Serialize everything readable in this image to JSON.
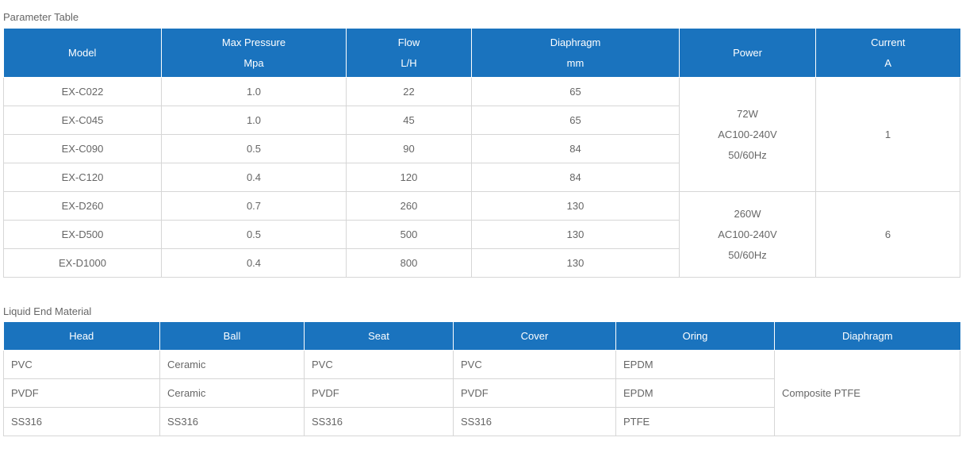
{
  "parameter_table": {
    "title": "Parameter Table",
    "headers": [
      {
        "l1": "Model",
        "l2": ""
      },
      {
        "l1": "Max Pressure",
        "l2": "Mpa"
      },
      {
        "l1": "Flow",
        "l2": "L/H"
      },
      {
        "l1": "Diaphragm",
        "l2": "mm"
      },
      {
        "l1": "Power",
        "l2": ""
      },
      {
        "l1": "Current",
        "l2": "A"
      }
    ],
    "rows": [
      [
        "EX-C022",
        "1.0",
        "22",
        "65"
      ],
      [
        "EX-C045",
        "1.0",
        "45",
        "65"
      ],
      [
        "EX-C090",
        "0.5",
        "90",
        "84"
      ],
      [
        "EX-C120",
        "0.4",
        "120",
        "84"
      ],
      [
        "EX-D260",
        "0.7",
        "260",
        "130"
      ],
      [
        "EX-D500",
        "0.5",
        "500",
        "130"
      ],
      [
        "EX-D1000",
        "0.4",
        "800",
        "130"
      ]
    ],
    "groups": [
      {
        "power": [
          "72W",
          "AC100-240V",
          "50/60Hz"
        ],
        "current": "1"
      },
      {
        "power": [
          "260W",
          "AC100-240V",
          "50/60Hz"
        ],
        "current": "6"
      }
    ]
  },
  "liquid_table": {
    "title": "Liquid End Material",
    "headers": [
      "Head",
      "Ball",
      "Seat",
      "Cover",
      "Oring",
      "Diaphragm"
    ],
    "rows": [
      [
        "PVC",
        "Ceramic",
        "PVC",
        "PVC",
        "EPDM"
      ],
      [
        "PVDF",
        "Ceramic",
        "PVDF",
        "PVDF",
        "EPDM"
      ],
      [
        "SS316",
        "SS316",
        "SS316",
        "SS316",
        "PTFE"
      ]
    ],
    "diaphragm": "Composite PTFE"
  },
  "colors": {
    "header_bg": "#1a73be",
    "header_text": "#ffffff",
    "border": "#d6d6d6"
  }
}
